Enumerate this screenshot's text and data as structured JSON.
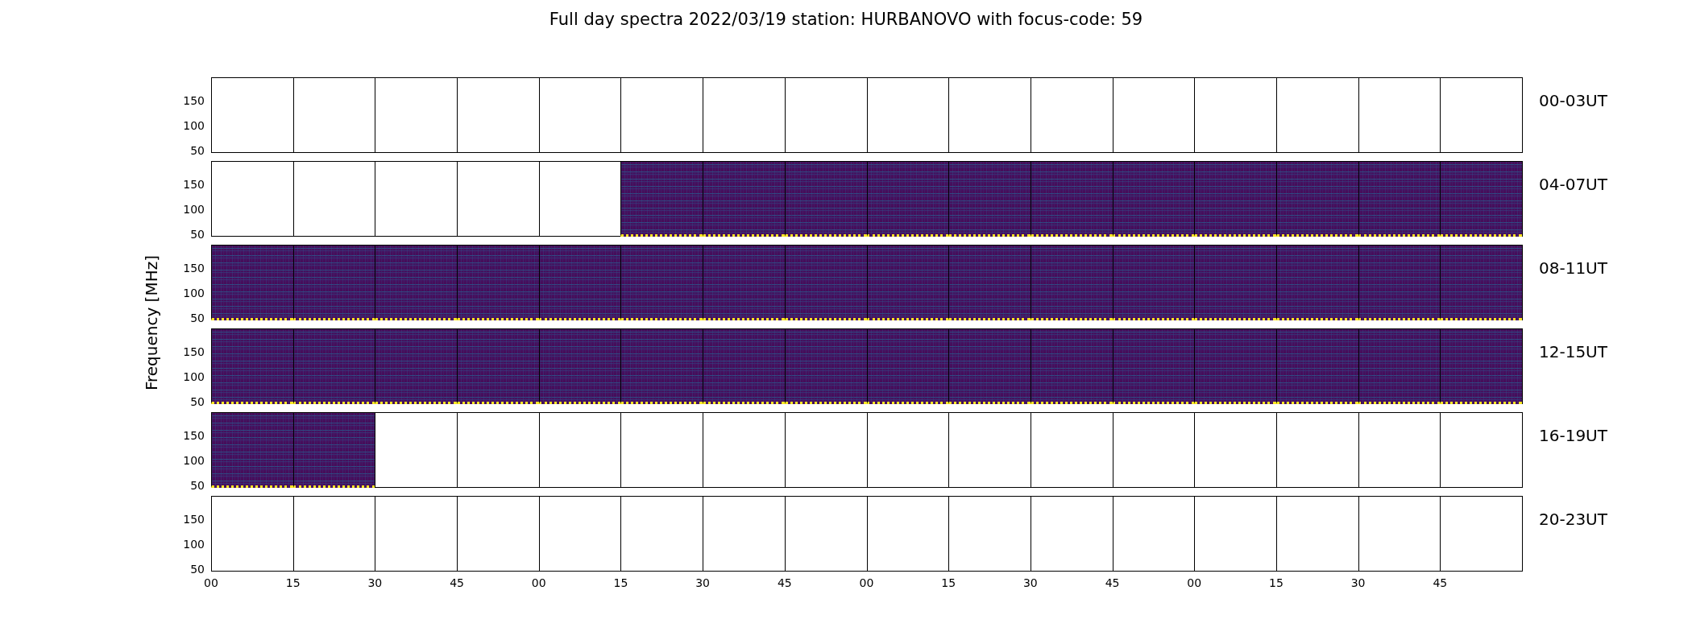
{
  "title": "Full day spectra 2022/03/19 station: HURBANOVO with focus-code: 59",
  "ylabel": "Frequency [MHz]",
  "rows": [
    {
      "label": "00-03UT",
      "y_ticks": [
        "150",
        "100",
        "50"
      ],
      "panels": [
        {
          "kind": "empty"
        },
        {
          "kind": "empty"
        },
        {
          "kind": "empty"
        },
        {
          "kind": "empty"
        },
        {
          "kind": "empty"
        },
        {
          "kind": "empty"
        },
        {
          "kind": "empty"
        },
        {
          "kind": "empty"
        },
        {
          "kind": "empty"
        },
        {
          "kind": "empty"
        },
        {
          "kind": "empty"
        },
        {
          "kind": "empty"
        },
        {
          "kind": "empty"
        },
        {
          "kind": "empty"
        },
        {
          "kind": "empty"
        },
        {
          "kind": "empty"
        }
      ]
    },
    {
      "label": "04-07UT",
      "y_ticks": [
        "150",
        "100",
        "50"
      ],
      "panels": [
        {
          "kind": "empty"
        },
        {
          "kind": "empty"
        },
        {
          "kind": "empty"
        },
        {
          "kind": "empty"
        },
        {
          "kind": "empty"
        },
        {
          "kind": "spectrogram"
        },
        {
          "kind": "spectrogram"
        },
        {
          "kind": "spectrogram"
        },
        {
          "kind": "spectrogram"
        },
        {
          "kind": "spectrogram"
        },
        {
          "kind": "spectrogram"
        },
        {
          "kind": "spectrogram"
        },
        {
          "kind": "spectrogram"
        },
        {
          "kind": "spectrogram"
        },
        {
          "kind": "spectrogram"
        },
        {
          "kind": "spectrogram"
        }
      ]
    },
    {
      "label": "08-11UT",
      "y_ticks": [
        "150",
        "100",
        "50"
      ],
      "panels": [
        {
          "kind": "spectrogram"
        },
        {
          "kind": "spectrogram"
        },
        {
          "kind": "spectrogram"
        },
        {
          "kind": "spectrogram"
        },
        {
          "kind": "spectrogram"
        },
        {
          "kind": "spectrogram"
        },
        {
          "kind": "spectrogram"
        },
        {
          "kind": "spectrogram"
        },
        {
          "kind": "spectrogram"
        },
        {
          "kind": "spectrogram"
        },
        {
          "kind": "spectrogram"
        },
        {
          "kind": "spectrogram"
        },
        {
          "kind": "spectrogram"
        },
        {
          "kind": "spectrogram"
        },
        {
          "kind": "spectrogram"
        },
        {
          "kind": "spectrogram"
        }
      ]
    },
    {
      "label": "12-15UT",
      "y_ticks": [
        "150",
        "100",
        "50"
      ],
      "panels": [
        {
          "kind": "spectrogram"
        },
        {
          "kind": "spectrogram"
        },
        {
          "kind": "spectrogram"
        },
        {
          "kind": "spectrogram"
        },
        {
          "kind": "spectrogram"
        },
        {
          "kind": "spectrogram"
        },
        {
          "kind": "spectrogram"
        },
        {
          "kind": "spectrogram"
        },
        {
          "kind": "spectrogram"
        },
        {
          "kind": "spectrogram"
        },
        {
          "kind": "spectrogram"
        },
        {
          "kind": "spectrogram"
        },
        {
          "kind": "spectrogram"
        },
        {
          "kind": "spectrogram"
        },
        {
          "kind": "spectrogram"
        },
        {
          "kind": "spectrogram"
        }
      ]
    },
    {
      "label": "16-19UT",
      "y_ticks": [
        "150",
        "100",
        "50"
      ],
      "panels": [
        {
          "kind": "spectrogram"
        },
        {
          "kind": "spectrogram"
        },
        {
          "kind": "empty"
        },
        {
          "kind": "empty"
        },
        {
          "kind": "empty"
        },
        {
          "kind": "empty"
        },
        {
          "kind": "empty"
        },
        {
          "kind": "empty"
        },
        {
          "kind": "empty"
        },
        {
          "kind": "empty"
        },
        {
          "kind": "empty"
        },
        {
          "kind": "empty"
        },
        {
          "kind": "empty"
        },
        {
          "kind": "empty"
        },
        {
          "kind": "empty"
        },
        {
          "kind": "empty"
        }
      ]
    },
    {
      "label": "20-23UT",
      "y_ticks": [
        "150",
        "100",
        "50"
      ],
      "panels": [
        {
          "kind": "empty"
        },
        {
          "kind": "empty"
        },
        {
          "kind": "empty"
        },
        {
          "kind": "empty"
        },
        {
          "kind": "empty"
        },
        {
          "kind": "empty"
        },
        {
          "kind": "empty"
        },
        {
          "kind": "empty"
        },
        {
          "kind": "empty"
        },
        {
          "kind": "empty"
        },
        {
          "kind": "empty"
        },
        {
          "kind": "empty"
        },
        {
          "kind": "empty"
        },
        {
          "kind": "empty"
        },
        {
          "kind": "empty"
        },
        {
          "kind": "empty"
        }
      ]
    }
  ],
  "x_ticks": [
    "00",
    "15",
    "30",
    "45",
    "00",
    "15",
    "30",
    "45",
    "00",
    "15",
    "30",
    "45",
    "00",
    "15",
    "30",
    "45"
  ]
}
